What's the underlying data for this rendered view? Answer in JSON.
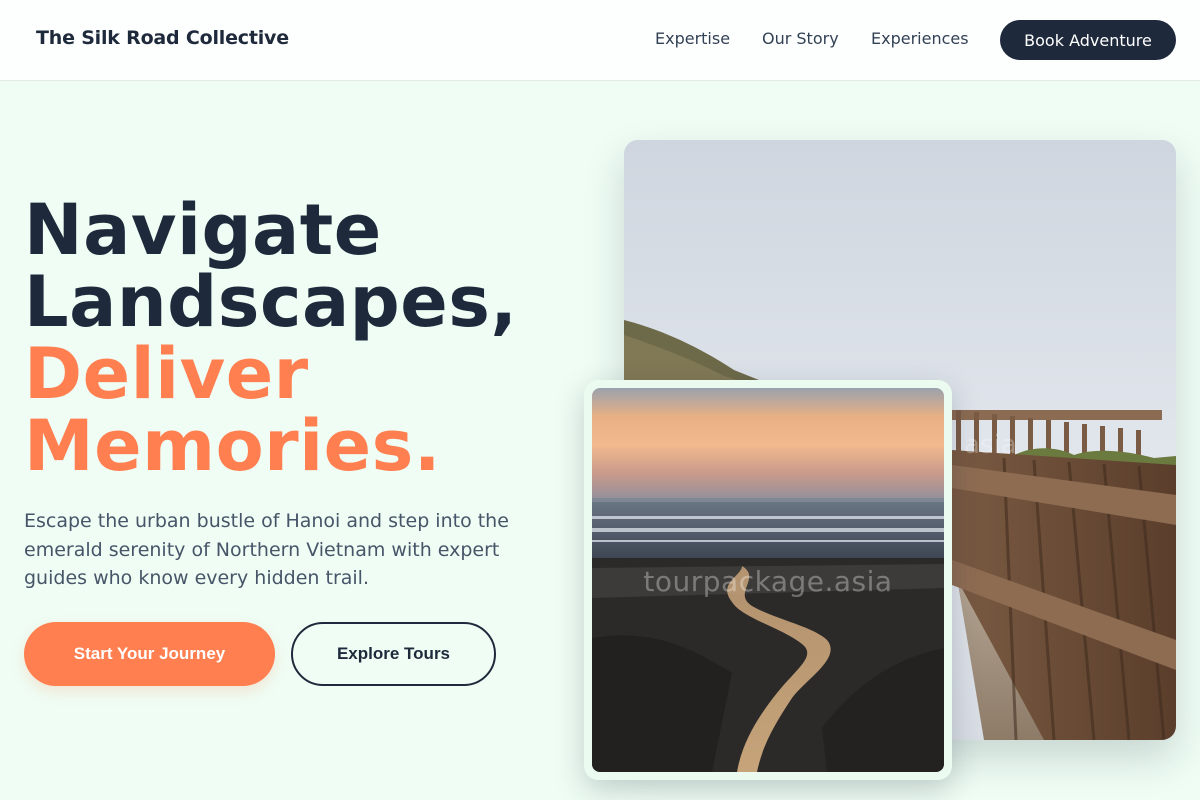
{
  "header": {
    "brand": "The Silk Road Collective",
    "nav": [
      "Expertise",
      "Our Story",
      "Experiences"
    ],
    "cta_label": "Book Adventure"
  },
  "hero": {
    "headline_line1": "Navigate",
    "headline_line2": "Landscapes,",
    "headline_accent_line1": "Deliver",
    "headline_accent_line2": "Memories.",
    "subtext": "Escape the urban bustle of Hanoi and step into the emerald serenity of Northern Vietnam with expert guides who know every hidden trail.",
    "primary_button": "Start Your Journey",
    "secondary_button": "Explore Tours"
  },
  "images": {
    "main_photo_watermark": "asia",
    "inset_photo_watermark": "tourpackage.asia"
  },
  "colors": {
    "primary_dark": "#1e293b",
    "accent_coral": "#ff7f50",
    "background_mint": "#effdf4",
    "body_text": "#475569"
  }
}
